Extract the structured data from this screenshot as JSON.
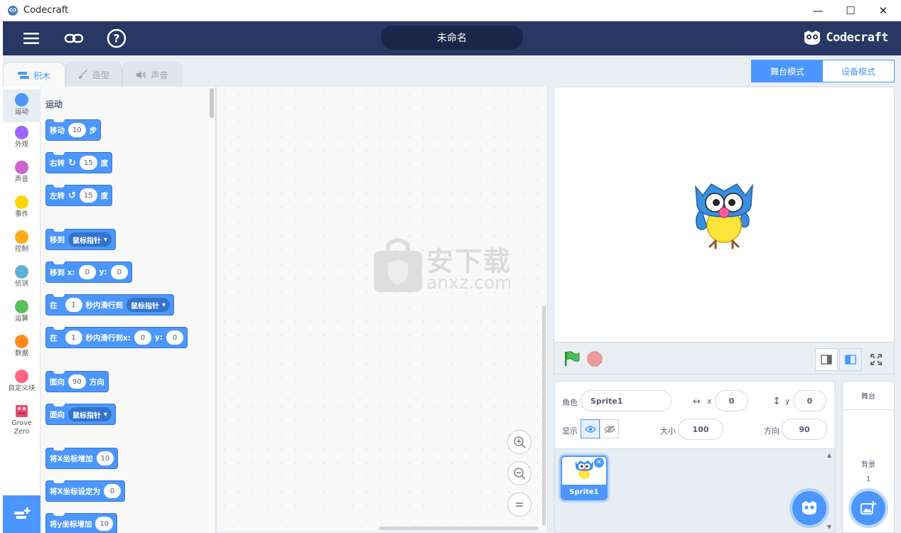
{
  "window": {
    "title": "Codecraft",
    "minimize": "—",
    "maximize": "☐",
    "close": "✕"
  },
  "header": {
    "project_title": "未命名",
    "brand": "Codecraft"
  },
  "tabs": [
    {
      "label": "积木",
      "active": true
    },
    {
      "label": "造型",
      "active": false
    },
    {
      "label": "声音",
      "active": false
    }
  ],
  "categories": [
    {
      "label": "运动",
      "color": "#4c97ff"
    },
    {
      "label": "外观",
      "color": "#9966ff"
    },
    {
      "label": "声音",
      "color": "#cf63cf"
    },
    {
      "label": "事件",
      "color": "#ffd500"
    },
    {
      "label": "控制",
      "color": "#ffab19"
    },
    {
      "label": "侦测",
      "color": "#5cb1d6"
    },
    {
      "label": "运算",
      "color": "#59c059"
    },
    {
      "label": "数据",
      "color": "#ff8c1a"
    },
    {
      "label": "自定义块",
      "color": "#ff6680"
    },
    {
      "label": "Grove Zero",
      "color": "#e64c6e"
    }
  ],
  "palette": {
    "title": "运动",
    "blocks": {
      "move": {
        "a": "移动",
        "v": "10",
        "b": "步"
      },
      "turn_right": {
        "a": "右转",
        "v": "15",
        "b": "度"
      },
      "turn_left": {
        "a": "左转",
        "v": "15",
        "b": "度"
      },
      "goto": {
        "a": "移到",
        "dd": "鼠标指针"
      },
      "goto_xy": {
        "a": "移到 x:",
        "x": "0",
        "b": "y:",
        "y": "0"
      },
      "glide_to": {
        "a": "在",
        "v": "1",
        "b": "秒内滑行到",
        "dd": "鼠标指针"
      },
      "glide_xy": {
        "a": "在",
        "v": "1",
        "b": "秒内滑行到x:",
        "x": "0",
        "c": "y:",
        "y": "0"
      },
      "point_dir": {
        "a": "面向",
        "v": "90",
        "b": "方向"
      },
      "point_to": {
        "a": "面向",
        "dd": "鼠标指针"
      },
      "change_x": {
        "a": "将X坐标增加",
        "v": "10"
      },
      "set_x": {
        "a": "将X坐标设定为",
        "v": "0"
      },
      "change_y": {
        "a": "将y坐标增加",
        "v": "10"
      }
    }
  },
  "watermark": {
    "cn": "安下载",
    "en": "anxz.com"
  },
  "modes": {
    "stage": "舞台模式",
    "device": "设备模式"
  },
  "sprite": {
    "label_name": "角色",
    "name": "Sprite1",
    "label_x": "x",
    "x": "0",
    "label_y": "y",
    "y": "0",
    "label_show": "显示",
    "label_size": "大小",
    "size": "100",
    "label_dir": "方向",
    "direction": "90"
  },
  "sprite_list": [
    {
      "name": "Sprite1"
    }
  ],
  "stage_panel": {
    "title": "舞台",
    "backdrop_label": "背景",
    "backdrop_count": "1"
  }
}
